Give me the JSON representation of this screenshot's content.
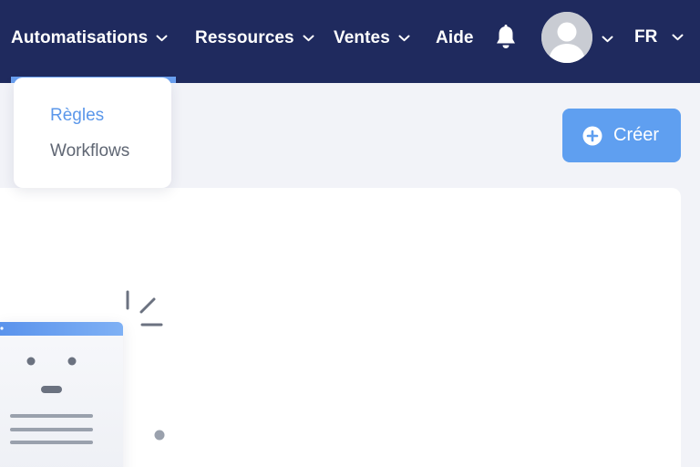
{
  "nav": {
    "items": [
      {
        "label": "Automatisations"
      },
      {
        "label": "Ressources"
      },
      {
        "label": "Ventes"
      },
      {
        "label": "Aide"
      }
    ],
    "language": "FR"
  },
  "dropdown": {
    "items": [
      {
        "label": "Règles",
        "active": true
      },
      {
        "label": "Workflows",
        "active": false
      }
    ]
  },
  "create_button": {
    "label": "Créer"
  },
  "colors": {
    "nav_bg": "#1f2a5e",
    "accent": "#5f9ff0",
    "active_link": "#5b97ea",
    "page_bg": "#f2f3f8"
  },
  "icons": {
    "bell": "bell-icon",
    "avatar": "user-avatar-icon",
    "chevron": "chevron-down-icon",
    "plus": "plus-circle-icon"
  }
}
